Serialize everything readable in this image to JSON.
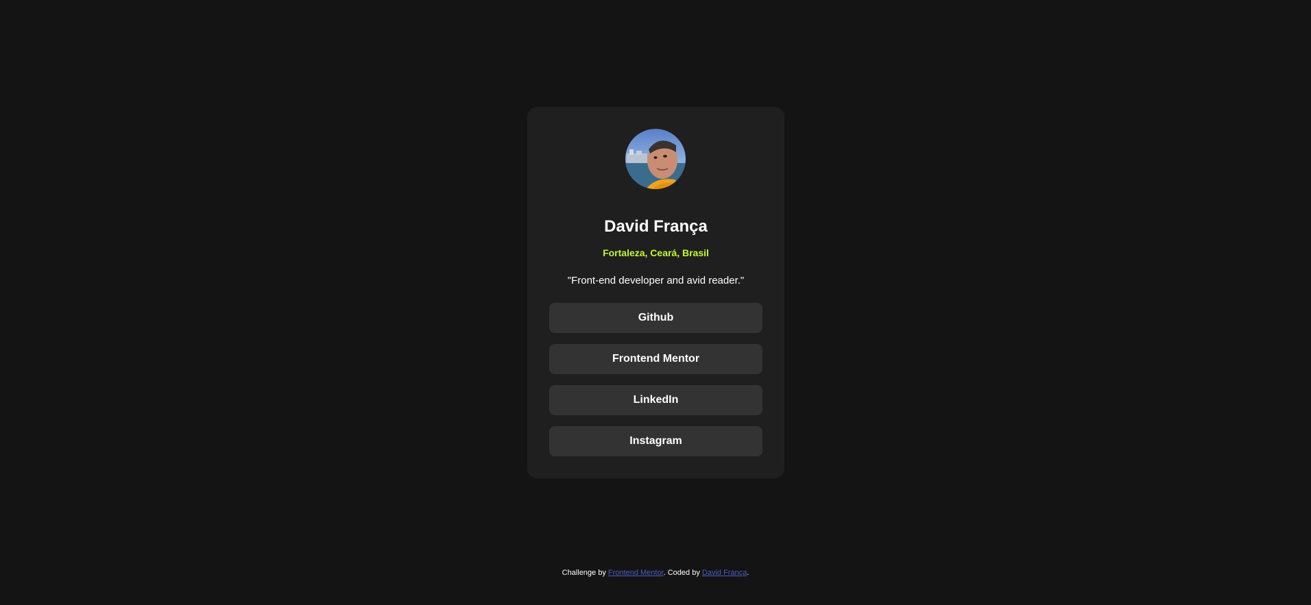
{
  "profile": {
    "name": "David França",
    "location": "Fortaleza, Ceará, Brasil",
    "bio": "\"Front-end developer and avid reader.\"",
    "avatar_icon": "profile-photo"
  },
  "links": [
    {
      "label": "Github"
    },
    {
      "label": "Frontend Mentor"
    },
    {
      "label": "LinkedIn"
    },
    {
      "label": "Instagram"
    }
  ],
  "footer": {
    "prefix": "Challenge by ",
    "link1": "Frontend Mentor",
    "middle": ". Coded by ",
    "link2": "David França",
    "suffix": "."
  },
  "colors": {
    "background": "#141414",
    "card": "#1f1f1f",
    "button": "#333333",
    "accent": "#c4f82a",
    "footer_link": "#4a5ec4"
  }
}
